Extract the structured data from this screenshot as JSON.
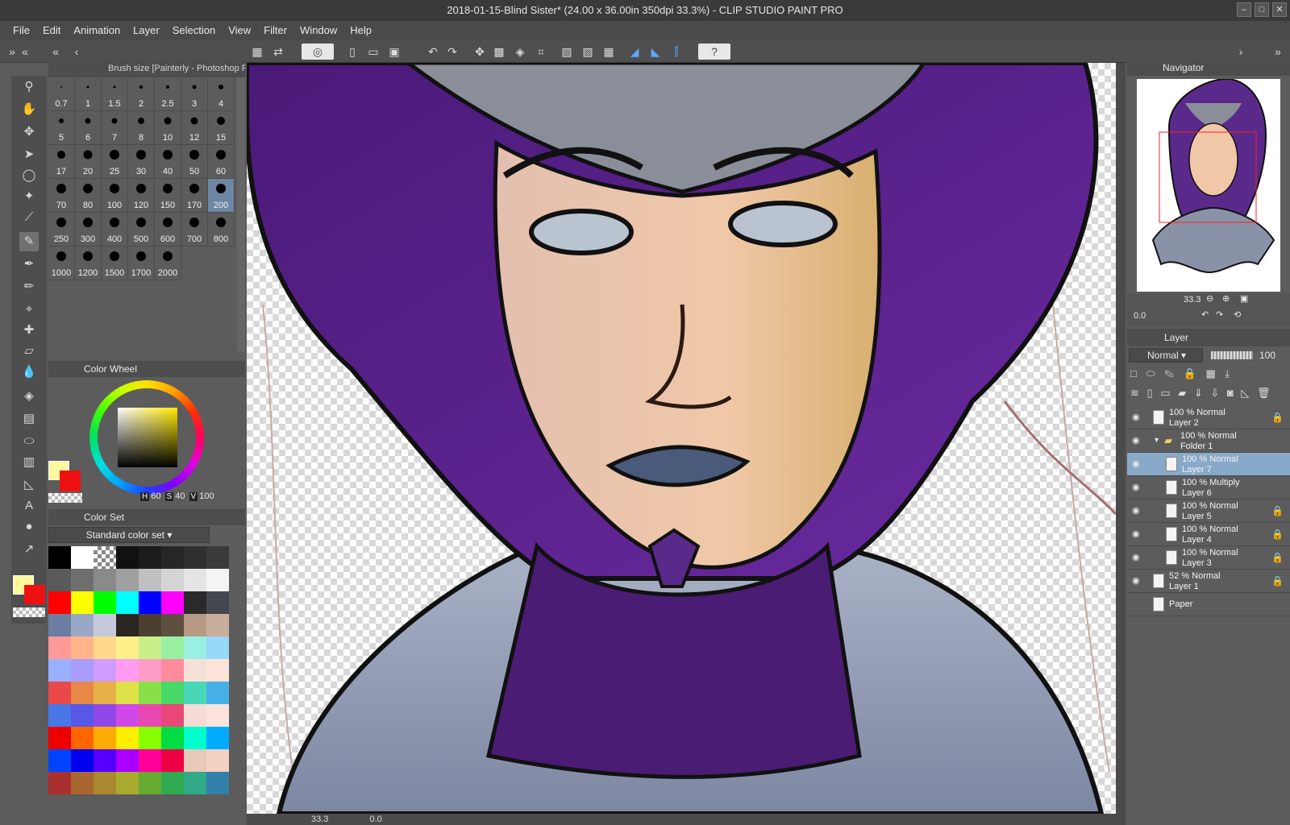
{
  "window": {
    "title": "2018-01-15-Blind Sister* (24.00 x 36.00in 350dpi 33.3%)  - CLIP STUDIO PAINT PRO"
  },
  "menu": [
    "File",
    "Edit",
    "Animation",
    "Layer",
    "Selection",
    "View",
    "Filter",
    "Window",
    "Help"
  ],
  "icons": {
    "command_bar": [
      "grid-icon",
      "image-swap-icon",
      "clip-studio-logo-icon",
      "new-file-icon",
      "open-folder-icon",
      "save-icon",
      "undo-icon",
      "redo-icon",
      "transform-icon",
      "clear-selection-icon",
      "fill-icon",
      "fit-icon",
      "snap-ruler-icon",
      "snap-grid-icon",
      "help-icon"
    ],
    "tools": [
      "zoom-icon",
      "hand-icon",
      "move-layer-icon",
      "object-select-icon",
      "lasso-icon",
      "magic-wand-icon",
      "eyedropper-icon",
      "pen-icon",
      "pencil-icon",
      "brush-icon",
      "airbrush-icon",
      "decoration-icon",
      "eraser-icon",
      "blend-icon",
      "fill-icon",
      "gradient-icon",
      "figure-icon",
      "frame-icon",
      "ruler-icon",
      "text-icon",
      "balloon-icon",
      "correct-line-icon"
    ]
  },
  "brush_panel": {
    "title": "Brush size [Painterly - Photoshop Rou",
    "sizes": [
      "0.7",
      "1",
      "1.5",
      "2",
      "2.5",
      "3",
      "4",
      "5",
      "6",
      "7",
      "8",
      "10",
      "12",
      "15",
      "17",
      "20",
      "25",
      "30",
      "40",
      "50",
      "60",
      "70",
      "80",
      "100",
      "120",
      "150",
      "170",
      "200",
      "250",
      "300",
      "400",
      "500",
      "600",
      "700",
      "800",
      "1000",
      "1200",
      "1500",
      "1700",
      "2000"
    ],
    "selected": "200"
  },
  "color_wheel": {
    "title": "Color Wheel",
    "h": "60",
    "s": "40",
    "v": "100",
    "h_key": "H",
    "s_key": "S",
    "v_key": "V",
    "main_color": "#fff79c",
    "sub_color": "#ee1111"
  },
  "color_set": {
    "title": "Color Set",
    "selected_set": "Standard color set",
    "swatches": [
      [
        "#000000",
        "#ffffff",
        "checker",
        "#111111",
        "#1c1c1c",
        "#262626",
        "#303030",
        "#3a3a3a"
      ],
      [
        "#5a5a5a",
        "#6e6e6e",
        "#8a8a8a",
        "#a0a0a0",
        "#c0c0c0",
        "#d4d4d4",
        "#e4e4e4",
        "#f4f4f4"
      ],
      [
        "#ff0000",
        "#ffff00",
        "#00ff00",
        "#00ffff",
        "#0000ff",
        "#ff00ff",
        "#2a2a2a",
        "#44484e"
      ],
      [
        "#6b7da0",
        "#9aa8c8",
        "#c6c9dc",
        "#2a2622",
        "#4a3f30",
        "#5e5040",
        "#b79a86",
        "#c9ae9c"
      ],
      [
        "#ff9a9a",
        "#ffb48a",
        "#ffd88a",
        "#fff08a",
        "#c8f08a",
        "#98f0a0",
        "#98f0e0",
        "#98d8f8"
      ],
      [
        "#9ab0ff",
        "#a89cff",
        "#d09cff",
        "#ff9cf0",
        "#ff9cc8",
        "#ff8c9c",
        "#f6e0d8",
        "#fde4d8"
      ],
      [
        "#e84848",
        "#e88848",
        "#e8b048",
        "#e0e048",
        "#88e048",
        "#48d868",
        "#48d8b8",
        "#48b0e8"
      ],
      [
        "#4878e8",
        "#5858e8",
        "#9048e8",
        "#d048e8",
        "#e848b0",
        "#e84878",
        "#f4dcd4",
        "#fbe4dc"
      ],
      [
        "#ee0000",
        "#ff6600",
        "#ffaa00",
        "#ffee00",
        "#88ff00",
        "#00dd44",
        "#00ffcc",
        "#00aaff"
      ],
      [
        "#0044ff",
        "#0000ee",
        "#5500ff",
        "#aa00ff",
        "#ff0099",
        "#ee0044",
        "#e8c8b8",
        "#f4d0c0"
      ],
      [
        "#aa3030",
        "#aa6630",
        "#aa8830",
        "#aaaa30",
        "#66aa30",
        "#30aa50",
        "#30aa88",
        "#3080aa"
      ]
    ]
  },
  "canvas": {
    "zoom": "33.3",
    "angle": "0.0"
  },
  "navigator": {
    "title": "Navigator",
    "zoom": "33.3",
    "angle": "0.0"
  },
  "layer_panel": {
    "title": "Layer",
    "blend_mode": "Normal",
    "opacity": "100",
    "layers": [
      {
        "mode": "100 % Normal",
        "name": "Layer 2",
        "indent": 0,
        "locked": true,
        "selected": false,
        "visible": true,
        "type": "raster"
      },
      {
        "mode": "100 % Normal",
        "name": "Folder 1",
        "indent": 0,
        "locked": false,
        "selected": false,
        "visible": true,
        "type": "folder"
      },
      {
        "mode": "100 % Normal",
        "name": "Layer 7",
        "indent": 1,
        "locked": false,
        "selected": true,
        "visible": true,
        "type": "raster"
      },
      {
        "mode": "100 % Multiply",
        "name": "Layer 6",
        "indent": 1,
        "locked": false,
        "selected": false,
        "visible": true,
        "type": "raster"
      },
      {
        "mode": "100 % Normal",
        "name": "Layer 5",
        "indent": 1,
        "locked": true,
        "selected": false,
        "visible": true,
        "type": "raster"
      },
      {
        "mode": "100 % Normal",
        "name": "Layer 4",
        "indent": 1,
        "locked": true,
        "selected": false,
        "visible": true,
        "type": "raster"
      },
      {
        "mode": "100 % Normal",
        "name": "Layer 3",
        "indent": 1,
        "locked": true,
        "selected": false,
        "visible": true,
        "type": "raster"
      },
      {
        "mode": "52 % Normal",
        "name": "Layer 1",
        "indent": 0,
        "locked": true,
        "selected": false,
        "visible": true,
        "type": "raster"
      },
      {
        "mode": "",
        "name": "Paper",
        "indent": 0,
        "locked": false,
        "selected": false,
        "visible": false,
        "type": "paper"
      }
    ]
  }
}
